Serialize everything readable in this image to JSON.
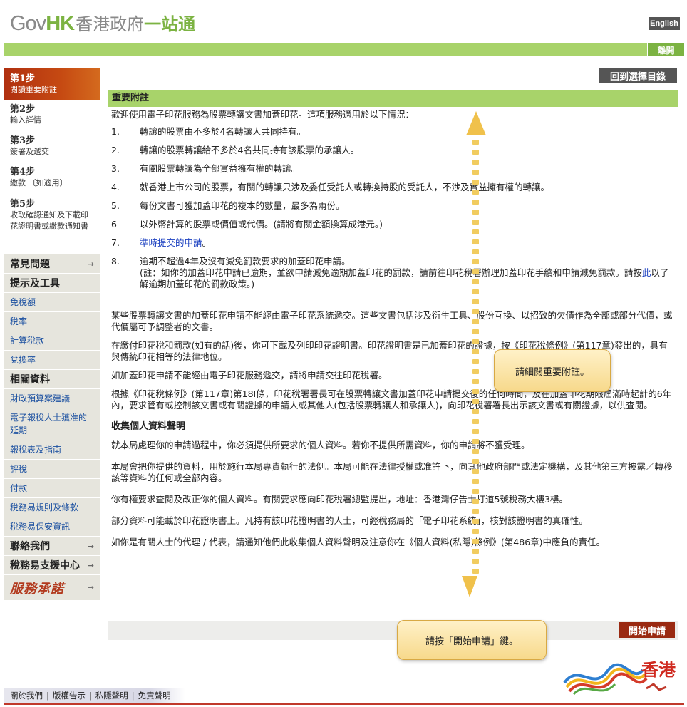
{
  "header": {
    "logo_gov": "Gov",
    "logo_hk": "HK",
    "logo_cn1": "香港政府",
    "logo_cn2": "一站通",
    "lang_label": "English",
    "logout_label": "離開"
  },
  "sidebar": {
    "steps": [
      {
        "num": "第1步",
        "desc": "閱讀重要附註"
      },
      {
        "num": "第2步",
        "desc": "輸入詳情"
      },
      {
        "num": "第3步",
        "desc": "簽署及遞交"
      },
      {
        "num": "第4步",
        "desc": "繳款 〔如適用〕"
      },
      {
        "num": "第5步",
        "desc": "收取確認通知及下載印花證明書或繳款通知書"
      }
    ],
    "faq": "常見問題",
    "tools_head": "提示及工具",
    "tools": [
      "免稅額",
      "稅率",
      "計算稅款",
      "兌換率"
    ],
    "related_head": "相關資料",
    "related": [
      "財政預算案建議",
      "電子報稅人士獲准的延期",
      "報稅表及指南",
      "評稅",
      "付款",
      "稅務易規則及條款",
      "稅務易保安資訊"
    ],
    "contact": "聯絡我們",
    "support": "稅務易支援中心",
    "pledge": "服務承諾"
  },
  "main": {
    "back_label": "回到選擇目錄",
    "section_title": "重要附註",
    "intro": "歡迎使用電子印花服務為股票轉讓文書加蓋印花。這項服務適用於以下情況：",
    "items": [
      {
        "n": "1.",
        "t": "轉讓的股票由不多於4名轉讓人共同持有。"
      },
      {
        "n": "2.",
        "t": "轉讓的股票轉讓給不多於4名共同持有該股票的承讓人。"
      },
      {
        "n": "3.",
        "t": "有關股票轉讓為全部實益擁有權的轉讓。"
      },
      {
        "n": "4.",
        "t": "就香港上市公司的股票，有關的轉讓只涉及委任受託人或轉換持股的受託人，不涉及實益擁有權的轉讓。"
      },
      {
        "n": "5.",
        "t": "每份文書可獲加蓋印花的複本的數量，最多為兩份。"
      },
      {
        "n": "6",
        "t": "以外幣計算的股票或價值或代價。(請將有關金額換算成港元。)"
      }
    ],
    "item7_n": "7.",
    "item7_link": "準時提交的申請",
    "item7_tail": "。",
    "item8_n": "8.",
    "item8_main": "逾期不超過4年及沒有減免罰款要求的加蓋印花申請。",
    "item8_note_a": "(註：如你的加蓋印花申請已逾期，並欲申請減免逾期加蓋印花的罰款，請前往印花稅署辦理加蓋印花手續和申請減免罰款。請按",
    "item8_note_link": "此",
    "item8_note_b": "以了解逾期加蓋印花的罰款政策。)",
    "para1": "某些股票轉讓文書的加蓋印花申請不能經由電子印花系統遞交。這些文書包括涉及衍生工具、股份互換、以招致的欠債作為全部或部分代價，或代價屬可予調整者的文書。",
    "para2": "在繳付印花稅和罰款(如有的話)後，你可下載及列印印花證明書。印花證明書是已加蓋印花的證據，按《印花稅條例》(第117章)發出的，具有與傳統印花相等的法律地位。",
    "para3": "如加蓋印花申請不能經由電子印花服務遞交，請將申請交往印花稅署。",
    "para4": "根據《印花稅條例》(第117章)第18I條，印花稅署署長可在股票轉讓文書加蓋印花申請提交後的任何時間，及在加蓋印花期限屆滿時起計的6年內，要求管有或控制該文書或有關證據的申請人或其他人(包括股票轉讓人和承讓人)，向印花稅署署長出示該文書或有關證據，以供查閱。",
    "privacy_title": "收集個人資料聲明",
    "privacy1": "就本局處理你的申請過程中，你必須提供所要求的個人資料。若你不提供所需資料，你的申請將不獲受理。",
    "privacy2": "本局會把你提供的資料，用於施行本局專責執行的法例。本局可能在法律授權或准許下，向其他政府部門或法定機構，及其他第三方披露／轉移該等資料的任何或全部內容。",
    "privacy3": "你有權要求查閱及改正你的個人資料。有關要求應向印花稅署總監提出，地址：香港灣仔告士打道5號稅務大樓3樓。",
    "privacy4": "部分資料可能載於印花證明書上。凡持有該印花證明書的人士，可經稅務局的「電子印花系統」，核對該證明書的真確性。",
    "privacy5": "如你是有關人士的代理 / 代表，請通知他們此收集個人資料聲明及注意你在《個人資料(私隱)條例》(第486章)中應負的責任。",
    "submit_label": "開始申請"
  },
  "callouts": {
    "read": "請細閱重要附註。",
    "start": "請按「開始申請」鍵。"
  },
  "brand": {
    "hk_text": "香港"
  },
  "footer": {
    "links": [
      "關於我們",
      "版權告示",
      "私隱聲明",
      "免責聲明"
    ],
    "sep": "|"
  },
  "colors": {
    "accent_green": "#a8d36a",
    "step_active": "#b03010",
    "submit": "#9a2a12"
  }
}
